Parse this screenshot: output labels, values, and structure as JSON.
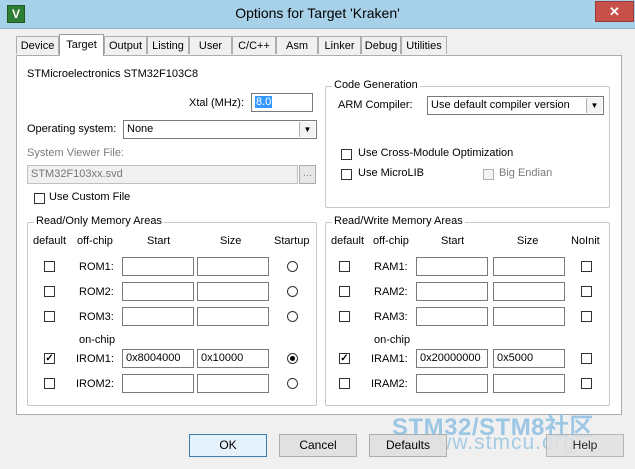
{
  "window": {
    "title": "Options for Target 'Kraken'",
    "icon_letter": "V",
    "close_glyph": "✕"
  },
  "tabs": [
    "Device",
    "Target",
    "Output",
    "Listing",
    "User",
    "C/C++",
    "Asm",
    "Linker",
    "Debug",
    "Utilities"
  ],
  "target": {
    "device_name": "STMicroelectronics STM32F103C8",
    "xtal_label": "Xtal (MHz):",
    "xtal_value": "8.0",
    "os_label": "Operating system:",
    "os_value": "None",
    "svd_label": "System Viewer File:",
    "svd_value": "STM32F103xx.svd",
    "browse_label": "...",
    "use_custom_file_label": "Use Custom File"
  },
  "code_generation": {
    "title": "Code Generation",
    "compiler_label": "ARM Compiler:",
    "compiler_value": "Use default compiler version",
    "cross_module_label": "Use Cross-Module Optimization",
    "microlib_label": "Use MicroLIB",
    "big_endian_label": "Big Endian"
  },
  "ro_memory": {
    "title": "Read/Only Memory Areas",
    "headers": {
      "default": "default",
      "offchip": "off-chip",
      "start": "Start",
      "size": "Size",
      "startup": "Startup"
    },
    "onchip_label": "on-chip",
    "rows": [
      {
        "label": "ROM1:",
        "start": "",
        "size": "",
        "default_checked": false,
        "startup": false
      },
      {
        "label": "ROM2:",
        "start": "",
        "size": "",
        "default_checked": false,
        "startup": false
      },
      {
        "label": "ROM3:",
        "start": "",
        "size": "",
        "default_checked": false,
        "startup": false
      },
      {
        "label": "IROM1:",
        "start": "0x8004000",
        "size": "0x10000",
        "default_checked": true,
        "startup": true
      },
      {
        "label": "IROM2:",
        "start": "",
        "size": "",
        "default_checked": false,
        "startup": false
      }
    ]
  },
  "rw_memory": {
    "title": "Read/Write Memory Areas",
    "headers": {
      "default": "default",
      "offchip": "off-chip",
      "start": "Start",
      "size": "Size",
      "noinit": "NoInit"
    },
    "onchip_label": "on-chip",
    "rows": [
      {
        "label": "RAM1:",
        "start": "",
        "size": "",
        "default_checked": false,
        "noinit": false
      },
      {
        "label": "RAM2:",
        "start": "",
        "size": "",
        "default_checked": false,
        "noinit": false
      },
      {
        "label": "RAM3:",
        "start": "",
        "size": "",
        "default_checked": false,
        "noinit": false
      },
      {
        "label": "IRAM1:",
        "start": "0x20000000",
        "size": "0x5000",
        "default_checked": true,
        "noinit": false
      },
      {
        "label": "IRAM2:",
        "start": "",
        "size": "",
        "default_checked": false,
        "noinit": false
      }
    ]
  },
  "buttons": {
    "ok": "OK",
    "cancel": "Cancel",
    "defaults": "Defaults",
    "help": "Help"
  },
  "watermark": {
    "line1": "STM32/STM8社区",
    "line2": "www.stmcu.org"
  },
  "check_glyph": "✓"
}
